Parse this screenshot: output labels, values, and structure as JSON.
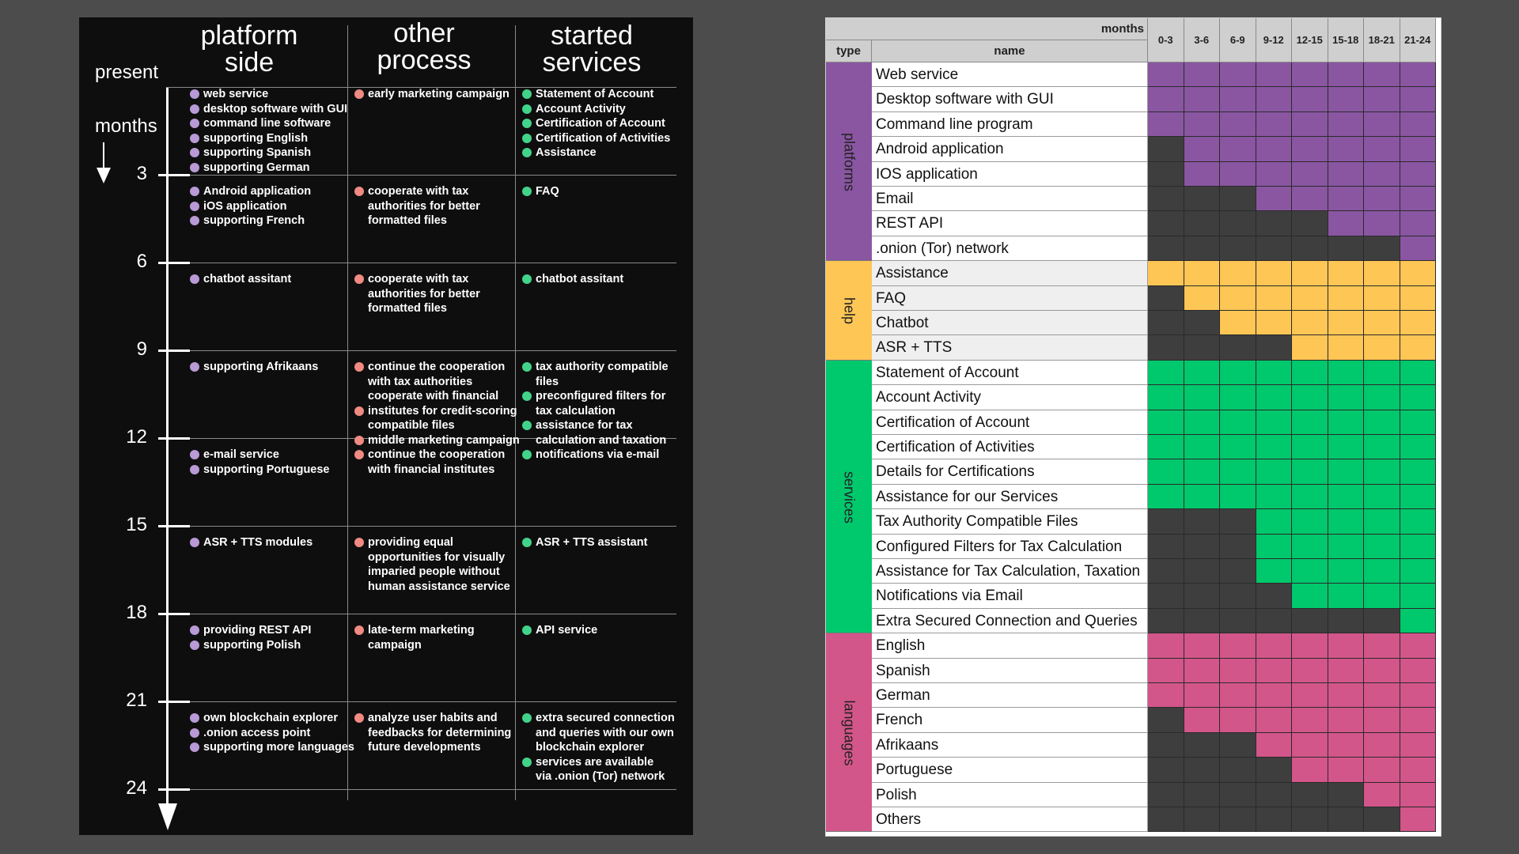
{
  "timeline": {
    "headers": {
      "platform": [
        "platform",
        "side"
      ],
      "other": [
        "other",
        "process"
      ],
      "services": [
        "started",
        "services"
      ]
    },
    "present_label": "present",
    "months_label": "months",
    "ticks": [
      "3",
      "6",
      "9",
      "12",
      "15",
      "18",
      "21",
      "24"
    ],
    "rows": [
      {
        "platform": [
          "web service",
          "desktop software with GUI",
          "command line software",
          "supporting English",
          "supporting Spanish",
          "supporting German"
        ],
        "other": [
          "early marketing campaign"
        ],
        "services": [
          "Statement of Account",
          "Account Activity",
          "Certification of Account",
          "Certification of Activities",
          "Assistance"
        ]
      },
      {
        "platform": [
          "Android application",
          "iOS application",
          "supporting French"
        ],
        "other": [
          "cooperate with tax\nauthorities for better\nformatted files"
        ],
        "services": [
          "FAQ"
        ]
      },
      {
        "platform": [
          "chatbot assitant"
        ],
        "other": [
          "cooperate with tax\nauthorities for better\nformatted files"
        ],
        "services": [
          "chatbot assitant"
        ]
      },
      {
        "platform": [
          "supporting Afrikaans"
        ],
        "other": [
          "continue the cooperation\nwith tax authorities\ncooperate with financial",
          "institutes for credit-scoring\ncompatible files",
          "middle marketing campaign"
        ],
        "services": [
          "tax authority compatible\nfiles",
          "preconfigured filters for\ntax calculation",
          "assistance for tax\ncalculation and taxation"
        ]
      },
      {
        "platform": [
          "e-mail service",
          "supporting Portuguese"
        ],
        "other": [
          "continue the cooperation\nwith financial institutes"
        ],
        "services": [
          "notifications via e-mail"
        ]
      },
      {
        "platform": [
          "ASR + TTS modules"
        ],
        "other": [
          "providing equal\nopportunities for visually\nimparied people without\nhuman assistance service"
        ],
        "services": [
          "ASR + TTS assistant"
        ]
      },
      {
        "platform": [
          "providing REST API",
          "supporting Polish"
        ],
        "other": [
          "late-term marketing\ncampaign"
        ],
        "services": [
          "API service"
        ]
      },
      {
        "platform": [
          "own blockchain explorer",
          ".onion access point",
          "supporting more languages"
        ],
        "other": [
          "analyze user habits and\nfeedbacks for determining\nfuture developments"
        ],
        "services": [
          "extra secured connection\nand queries with our own\nblockchain explorer",
          "services are available\nvia .onion (Tor) network"
        ]
      }
    ]
  },
  "grid": {
    "months_label": "months",
    "type_label": "type",
    "name_label": "name",
    "periods": [
      "0-3",
      "3-6",
      "6-9",
      "9-12",
      "12-15",
      "15-18",
      "18-21",
      "21-24"
    ],
    "colors": {
      "platforms": "#8a56a2",
      "help": "#fdc655",
      "services": "#00c86c",
      "languages": "#d3568a",
      "inactive": "#3e3e3e"
    },
    "groups": [
      {
        "type": "platforms",
        "items": [
          {
            "name": "Web service",
            "start": 0
          },
          {
            "name": "Desktop software with GUI",
            "start": 0
          },
          {
            "name": "Command line program",
            "start": 0
          },
          {
            "name": "Android application",
            "start": 1
          },
          {
            "name": "IOS application",
            "start": 1
          },
          {
            "name": "Email",
            "start": 3
          },
          {
            "name": "REST API",
            "start": 5
          },
          {
            "name": ".onion (Tor) network",
            "start": 7
          }
        ]
      },
      {
        "type": "help",
        "items": [
          {
            "name": "Assistance",
            "start": 0
          },
          {
            "name": "FAQ",
            "start": 1
          },
          {
            "name": "Chatbot",
            "start": 2
          },
          {
            "name": "ASR + TTS",
            "start": 4
          }
        ]
      },
      {
        "type": "services",
        "items": [
          {
            "name": "Statement of Account",
            "start": 0
          },
          {
            "name": "Account Activity",
            "start": 0
          },
          {
            "name": "Certification of Account",
            "start": 0
          },
          {
            "name": "Certification of Activities",
            "start": 0
          },
          {
            "name": "Details for Certifications",
            "start": 0
          },
          {
            "name": "Assistance for our Services",
            "start": 0
          },
          {
            "name": "Tax Authority Compatible Files",
            "start": 3
          },
          {
            "name": "Configured Filters for Tax Calculation",
            "start": 3
          },
          {
            "name": "Assistance for Tax Calculation, Taxation",
            "start": 3
          },
          {
            "name": "Notifications via Email",
            "start": 4
          },
          {
            "name": "Extra Secured Connection and Queries",
            "start": 7
          }
        ]
      },
      {
        "type": "languages",
        "items": [
          {
            "name": "English",
            "start": 0
          },
          {
            "name": "Spanish",
            "start": 0
          },
          {
            "name": "German",
            "start": 0
          },
          {
            "name": "French",
            "start": 1
          },
          {
            "name": "Afrikaans",
            "start": 3
          },
          {
            "name": "Portuguese",
            "start": 4
          },
          {
            "name": "Polish",
            "start": 6
          },
          {
            "name": "Others",
            "start": 7
          }
        ]
      }
    ]
  }
}
